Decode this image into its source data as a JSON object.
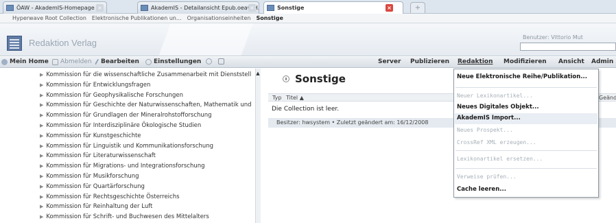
{
  "browser": {
    "tabs": [
      {
        "label": "ÖAW - AkademIS-Homepage",
        "active": false
      },
      {
        "label": "AkademIS - Detailansicht Epub.oeaw H...",
        "active": false
      },
      {
        "label": "Sonstige",
        "active": true
      }
    ],
    "new_tab_glyph": "+"
  },
  "breadcrumb": [
    "Hyperwave Root Collection",
    "Elektronische Publikationen un...",
    "Organisationseinheiten",
    "Sonstige"
  ],
  "header": {
    "app_title": "Redaktion Verlag",
    "user_label": "Benutzer: Vittorio Mut"
  },
  "toolbar": {
    "home": "Mein Home",
    "logout": "Abmelden",
    "edit": "Bearbeiten",
    "settings": "Einstellungen",
    "menus": [
      "Server",
      "Publizieren",
      "Redaktion",
      "Modifizieren",
      "Ansicht",
      "Admin"
    ],
    "active_menu": "Redaktion"
  },
  "tree": {
    "items": [
      "Kommission für die wissenschaftliche Zusammenarbeit mit Dienststell",
      "Kommission für Entwicklungsfragen",
      "Kommission für Geophysikalische Forschungen",
      "Kommission für Geschichte der Naturwissenschaften, Mathematik und",
      "Kommission für Grundlagen der Mineralrohstofforschung",
      "Kommission für Interdisziplinäre Ökologische Studien",
      "Kommission für Kunstgeschichte",
      "Kommission für Linguistik und Kommunikationsforschung",
      "Kommission für Literaturwissenschaft",
      "Kommission für Migrations- und Integrationsforschung",
      "Kommission für Musikforschung",
      "Kommission für Quartärforschung",
      "Kommission für Rechtsgeschichte Österreichs",
      "Kommission für Reinhaltung der Luft",
      "Kommission für Schrift- und Buchwesen des Mittelalters"
    ]
  },
  "content": {
    "title": "Sonstige",
    "columns": {
      "typ": "Typ",
      "titel": "Titel ▲",
      "geaendert": "Geänd"
    },
    "empty_message": "Die Collection ist leer.",
    "owner_line": "Besitzer: hwsystem • Zuletzt geändert am: 16/12/2008"
  },
  "dropdown": {
    "items": [
      {
        "label": "Neue Elektronische Reihe/Publikation...",
        "enabled": true
      },
      {
        "label": "Neuer Lexikonartikel...",
        "enabled": false
      },
      {
        "label": "Neues Digitales Objekt...",
        "enabled": true
      },
      {
        "label": "AkademIS Import...",
        "enabled": true
      },
      {
        "label": "Neues Prospekt...",
        "enabled": false
      },
      {
        "label": "CrossRef XML erzeugen...",
        "enabled": false
      },
      {
        "label": "Lexikonartikel ersetzen...",
        "enabled": false
      },
      {
        "label": "Verweise prüfen...",
        "enabled": false
      },
      {
        "label": "Cache leeren...",
        "enabled": true
      }
    ]
  }
}
